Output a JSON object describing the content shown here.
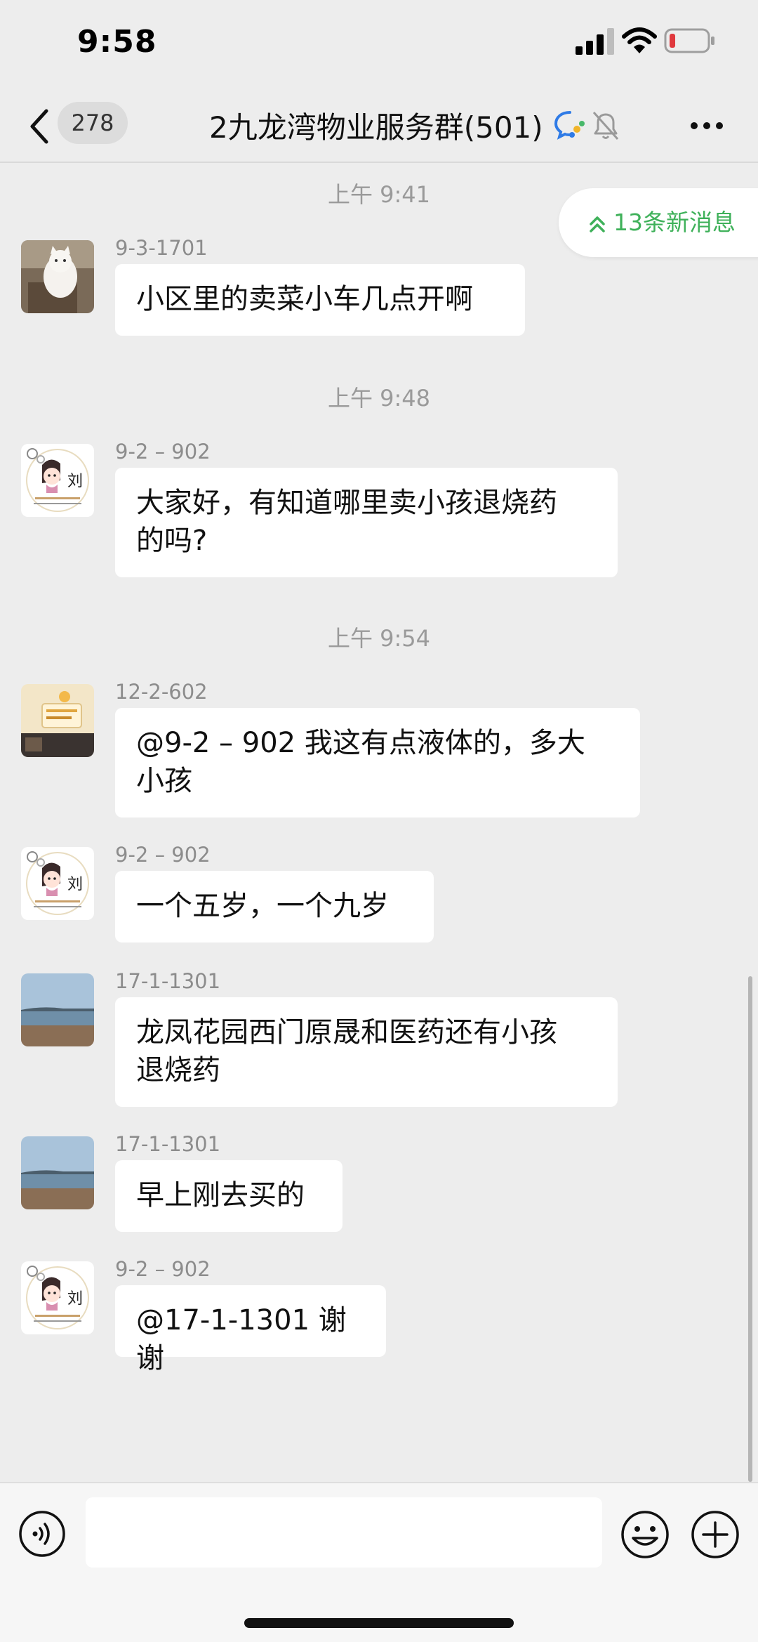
{
  "status_bar": {
    "time": "9:58"
  },
  "header": {
    "unread_count": "278",
    "title": "2九龙湾物业服务群(501)",
    "icons": [
      "back-icon",
      "wecom-icon",
      "mute-bell-icon",
      "more-icon"
    ]
  },
  "new_messages": {
    "label": "13条新消息",
    "icon": "double-chevron-up-icon"
  },
  "timestamps": [
    "上午 9:41",
    "上午 9:48",
    "上午 9:54"
  ],
  "messages": [
    {
      "sender": "9-3-1701",
      "lines": [
        "小区里的卖菜小车几点开啊"
      ],
      "avatar": "cat-avatar"
    },
    {
      "sender": "9-2 – 902",
      "lines": [
        "大家好，有知道哪里卖小孩退烧药",
        "的吗?"
      ],
      "avatar": "cartoon-girl-avatar"
    },
    {
      "sender": "12-2-602",
      "lines": [
        "@9-2 – 902 我这有点液体的，多大",
        "小孩"
      ],
      "avatar": "photo-avatar"
    },
    {
      "sender": "9-2 – 902",
      "lines": [
        "一个五岁，一个九岁"
      ],
      "avatar": "cartoon-girl-avatar"
    },
    {
      "sender": "17-1-1301",
      "lines": [
        "龙凤花园西门原晟和医药还有小孩",
        "退烧药"
      ],
      "avatar": "seaside-avatar"
    },
    {
      "sender": "17-1-1301",
      "lines": [
        "早上刚去买的"
      ],
      "avatar": "seaside-avatar"
    },
    {
      "sender": "9-2 – 902",
      "lines": [
        "@17-1-1301 谢谢"
      ],
      "avatar": "cartoon-girl-avatar"
    }
  ],
  "input_bar": {
    "value": "",
    "placeholder": ""
  },
  "colors": {
    "background": "#ededed",
    "bubble": "#ffffff",
    "accent_green": "#3fb15a",
    "timestamp": "#9a9a9a"
  }
}
